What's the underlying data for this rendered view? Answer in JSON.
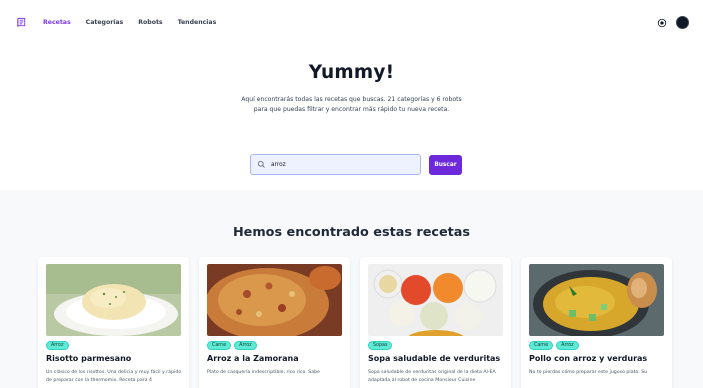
{
  "nav": {
    "logo_icon": "book-icon",
    "links": [
      {
        "label": "Recetas",
        "active": true
      },
      {
        "label": "Categorías",
        "active": false
      },
      {
        "label": "Robots",
        "active": false
      },
      {
        "label": "Tendencias",
        "active": false
      }
    ],
    "theme_icon": "theme-toggle-icon",
    "avatar_icon": "user-avatar"
  },
  "hero": {
    "title": "Yummy!",
    "subtitle": "Aquí encontrarás todas las recetas que buscas. 21 categorías y 6 robots para que puedas filtrar y encontrar más rápido tu nueva receta."
  },
  "search": {
    "value": "arroz",
    "placeholder": "",
    "button_label": "Buscar"
  },
  "results": {
    "title": "Hemos encontrado estas recetas",
    "cards": [
      {
        "tags": [
          "Arroz"
        ],
        "title": "Risotto parmesano",
        "desc": "Un clásico de los risottos. Una delicia y muy fácil y rápido de preparar con la thermomix. Receta para 4"
      },
      {
        "tags": [
          "Carne",
          "Arroz"
        ],
        "title": "Arroz a la Zamorana",
        "desc": "Plato de casquería indescriptible, rico rico. Sabe"
      },
      {
        "tags": [
          "Sopas"
        ],
        "title": "Sopa saludable de verduritas",
        "desc": "Sopa saludable de verduritas original de la dieta Al-EA adaptada al robot de cocina Monsieur Cuisine"
      },
      {
        "tags": [
          "Carne",
          "Arroz"
        ],
        "title": "Pollo con arroz y verduras",
        "desc": "No te pierdas cómo preparar este jugoso plato. Su"
      }
    ]
  },
  "colors": {
    "accent": "#7c3aed",
    "button": "#6d28d9",
    "tag": "#5eead4",
    "results_bg": "#f8f9fb"
  }
}
